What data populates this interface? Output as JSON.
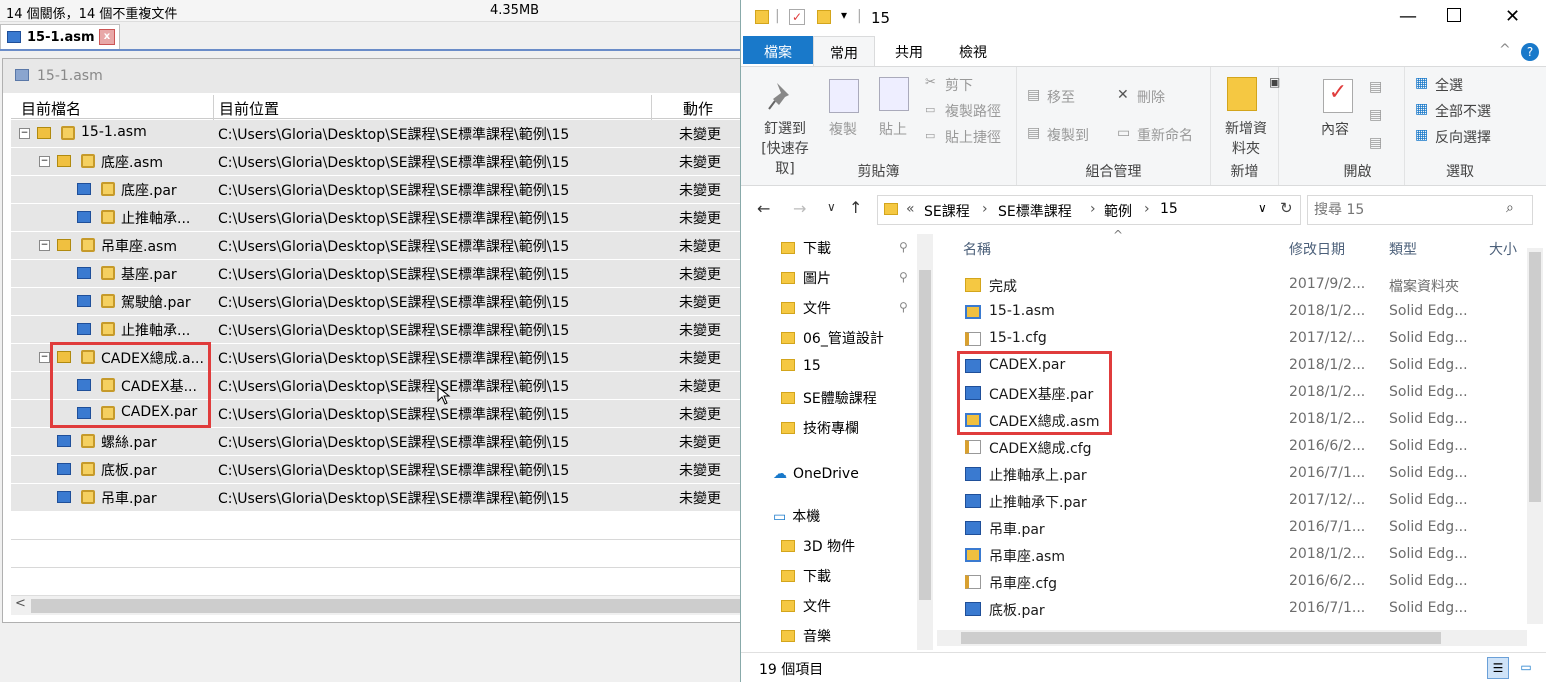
{
  "left_app": {
    "summary": "14 個關係，14 個不重複文件",
    "size": "4.35MB",
    "doc_tab": {
      "label": "15-1.asm",
      "close": "x"
    },
    "panel_title": "15-1.asm",
    "columns": {
      "name": "目前檔名",
      "location": "目前位置",
      "action": "動作"
    },
    "rows": [
      {
        "name": "15-1.asm",
        "location": "C:\\Users\\Gloria\\Desktop\\SE課程\\SE標準課程\\範例\\15",
        "action": "未變更",
        "level": 0,
        "expand": "−",
        "kind": "asm"
      },
      {
        "name": "底座.asm",
        "location": "C:\\Users\\Gloria\\Desktop\\SE課程\\SE標準課程\\範例\\15",
        "action": "未變更",
        "level": 1,
        "expand": "−",
        "kind": "asm"
      },
      {
        "name": "底座.par",
        "location": "C:\\Users\\Gloria\\Desktop\\SE課程\\SE標準課程\\範例\\15",
        "action": "未變更",
        "level": 2,
        "expand": "",
        "kind": "par"
      },
      {
        "name": "止推軸承...",
        "location": "C:\\Users\\Gloria\\Desktop\\SE課程\\SE標準課程\\範例\\15",
        "action": "未變更",
        "level": 2,
        "expand": "",
        "kind": "par"
      },
      {
        "name": "吊車座.asm",
        "location": "C:\\Users\\Gloria\\Desktop\\SE課程\\SE標準課程\\範例\\15",
        "action": "未變更",
        "level": 1,
        "expand": "−",
        "kind": "asm"
      },
      {
        "name": "基座.par",
        "location": "C:\\Users\\Gloria\\Desktop\\SE課程\\SE標準課程\\範例\\15",
        "action": "未變更",
        "level": 2,
        "expand": "",
        "kind": "par"
      },
      {
        "name": "駕駛艙.par",
        "location": "C:\\Users\\Gloria\\Desktop\\SE課程\\SE標準課程\\範例\\15",
        "action": "未變更",
        "level": 2,
        "expand": "",
        "kind": "par"
      },
      {
        "name": "止推軸承...",
        "location": "C:\\Users\\Gloria\\Desktop\\SE課程\\SE標準課程\\範例\\15",
        "action": "未變更",
        "level": 2,
        "expand": "",
        "kind": "par"
      },
      {
        "name": "CADEX總成.a...",
        "location": "C:\\Users\\Gloria\\Desktop\\SE課程\\SE標準課程\\範例\\15",
        "action": "未變更",
        "level": 1,
        "expand": "−",
        "kind": "asm"
      },
      {
        "name": "CADEX基...",
        "location": "C:\\Users\\Gloria\\Desktop\\SE課程\\SE標準課程\\範例\\15",
        "action": "未變更",
        "level": 2,
        "expand": "",
        "kind": "par"
      },
      {
        "name": "CADEX.par",
        "location": "C:\\Users\\Gloria\\Desktop\\SE課程\\SE標準課程\\範例\\15",
        "action": "未變更",
        "level": 2,
        "expand": "",
        "kind": "par"
      },
      {
        "name": "螺絲.par",
        "location": "C:\\Users\\Gloria\\Desktop\\SE課程\\SE標準課程\\範例\\15",
        "action": "未變更",
        "level": 1,
        "expand": "",
        "kind": "par"
      },
      {
        "name": "底板.par",
        "location": "C:\\Users\\Gloria\\Desktop\\SE課程\\SE標準課程\\範例\\15",
        "action": "未變更",
        "level": 1,
        "expand": "",
        "kind": "par"
      },
      {
        "name": "吊車.par",
        "location": "C:\\Users\\Gloria\\Desktop\\SE課程\\SE標準課程\\範例\\15",
        "action": "未變更",
        "level": 1,
        "expand": "",
        "kind": "par"
      }
    ]
  },
  "explorer": {
    "title": "15",
    "ribbon_tabs": {
      "file": "檔案",
      "home": "常用",
      "share": "共用",
      "view": "檢視"
    },
    "clipboard": {
      "pin": "釘選到 [快速存取]",
      "copy": "複製",
      "paste": "貼上",
      "cut": "剪下",
      "copy_path": "複製路徑",
      "paste_shortcut": "貼上捷徑",
      "label": "剪貼簿"
    },
    "organize": {
      "move_to": "移至",
      "copy_to": "複製到",
      "delete": "刪除",
      "rename": "重新命名",
      "label": "組合管理"
    },
    "new": {
      "new_folder": "新增資料夾",
      "label": "新增"
    },
    "open": {
      "properties": "內容",
      "label": "開啟"
    },
    "select": {
      "select_all": "全選",
      "select_none": "全部不選",
      "invert": "反向選擇",
      "label": "選取"
    },
    "address": {
      "prefix": "«",
      "crumbs": [
        "SE課程",
        "SE標準課程",
        "範例",
        "15"
      ]
    },
    "search_placeholder": "搜尋 15",
    "nav_items": [
      {
        "label": "下載",
        "pinned": true
      },
      {
        "label": "圖片",
        "pinned": true
      },
      {
        "label": "文件",
        "pinned": true
      },
      {
        "label": "06_管道設計",
        "pinned": false
      },
      {
        "label": "15",
        "pinned": false
      },
      {
        "label": "SE體驗課程",
        "pinned": false
      },
      {
        "label": "技術專欄",
        "pinned": false
      }
    ],
    "onedrive": "OneDrive",
    "thispc": "本機",
    "pc_items": [
      "3D 物件",
      "下載",
      "文件",
      "音樂"
    ],
    "list_headers": {
      "name": "名稱",
      "date": "修改日期",
      "type": "類型",
      "size": "大小"
    },
    "files": [
      {
        "name": "完成",
        "date": "2017/9/2...",
        "type": "檔案資料夾",
        "kind": "folder"
      },
      {
        "name": "15-1.asm",
        "date": "2018/1/2...",
        "type": "Solid Edg...",
        "kind": "asm"
      },
      {
        "name": "15-1.cfg",
        "date": "2017/12/...",
        "type": "Solid Edg...",
        "kind": "cfg"
      },
      {
        "name": "CADEX.par",
        "date": "2018/1/2...",
        "type": "Solid Edg...",
        "kind": "par"
      },
      {
        "name": "CADEX基座.par",
        "date": "2018/1/2...",
        "type": "Solid Edg...",
        "kind": "par"
      },
      {
        "name": "CADEX總成.asm",
        "date": "2018/1/2...",
        "type": "Solid Edg...",
        "kind": "asm"
      },
      {
        "name": "CADEX總成.cfg",
        "date": "2016/6/2...",
        "type": "Solid Edg...",
        "kind": "cfg"
      },
      {
        "name": "止推軸承上.par",
        "date": "2016/7/1...",
        "type": "Solid Edg...",
        "kind": "par"
      },
      {
        "name": "止推軸承下.par",
        "date": "2017/12/...",
        "type": "Solid Edg...",
        "kind": "par"
      },
      {
        "name": "吊車.par",
        "date": "2016/7/1...",
        "type": "Solid Edg...",
        "kind": "par"
      },
      {
        "name": "吊車座.asm",
        "date": "2018/1/2...",
        "type": "Solid Edg...",
        "kind": "asm"
      },
      {
        "name": "吊車座.cfg",
        "date": "2016/6/2...",
        "type": "Solid Edg...",
        "kind": "cfg"
      },
      {
        "name": "底板.par",
        "date": "2016/7/1...",
        "type": "Solid Edg...",
        "kind": "par"
      }
    ],
    "status": "19 個項目"
  },
  "colors": {
    "accent": "#1979ca",
    "highlight": "#e03c3c",
    "folder": "#f5c842"
  }
}
